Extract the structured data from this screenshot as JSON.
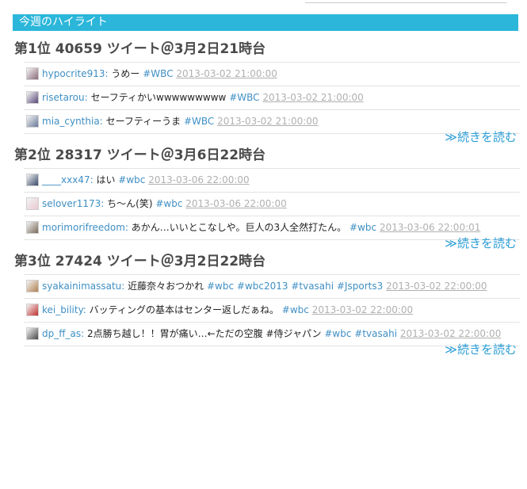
{
  "section": {
    "title": "今週のハイライト"
  },
  "ranks": [
    {
      "title": "第1位 40659 ツイート＠3月2日21時台",
      "read_more": "≫続きを読む",
      "tweets": [
        {
          "user": "hypocrite913:",
          "text": "うめー",
          "tags": "#WBC",
          "time": "2013-03-02 21:00:00",
          "avatar_color": "#8a6a7a"
        },
        {
          "user": "risetarou:",
          "text": "セーフティかいwwwwwwwww",
          "tags": "#WBC",
          "time": "2013-03-02 21:00:00",
          "avatar_color": "#5a4a7a"
        },
        {
          "user": "mia_cynthia:",
          "text": "セーフティーうま",
          "tags": "#WBC",
          "time": "2013-03-02 21:00:00",
          "avatar_color": "#6a7a9a"
        }
      ]
    },
    {
      "title": "第2位 28317 ツイート＠3月6日22時台",
      "read_more": "≫続きを読む",
      "tweets": [
        {
          "user": "____xxx47:",
          "text": "はい",
          "tags": "#wbc",
          "time": "2013-03-06 22:00:00",
          "avatar_color": "#3a4a6a"
        },
        {
          "user": "selover1173:",
          "text": "ち～ん(笑)",
          "tags": "#wbc",
          "time": "2013-03-06 22:00:00",
          "avatar_color": "#e8c8d0"
        },
        {
          "user": "morimorifreedom:",
          "text": "あかん…いいとこなしや。巨人の3人全然打たん。",
          "tags": "#wbc",
          "time": "2013-03-06 22:00:01",
          "avatar_color": "#7a6a5a"
        }
      ]
    },
    {
      "title": "第3位 27424 ツイート＠3月2日22時台",
      "read_more": "≫続きを読む",
      "tweets": [
        {
          "user": "syakainimassatu:",
          "text": "近藤奈々おつかれ",
          "tags": "#wbc #wbc2013 #tvasahi #Jsports3",
          "time": "2013-03-02 22:00:00",
          "avatar_color": "#b08050"
        },
        {
          "user": "kei_bility:",
          "text": "バッティングの基本はセンター返しだぁね。",
          "tags": "#wbc",
          "time": "2013-03-02 22:00:00",
          "avatar_color": "#c03030"
        },
        {
          "user": "dp_ff_as:",
          "text": "2点勝ち越し！！胃が痛い…←ただの空腹 #侍ジャパン",
          "tags": "#wbc #tvasahi",
          "time": "2013-03-02 22:00:00",
          "avatar_color": "#4a4a4a"
        }
      ]
    }
  ]
}
